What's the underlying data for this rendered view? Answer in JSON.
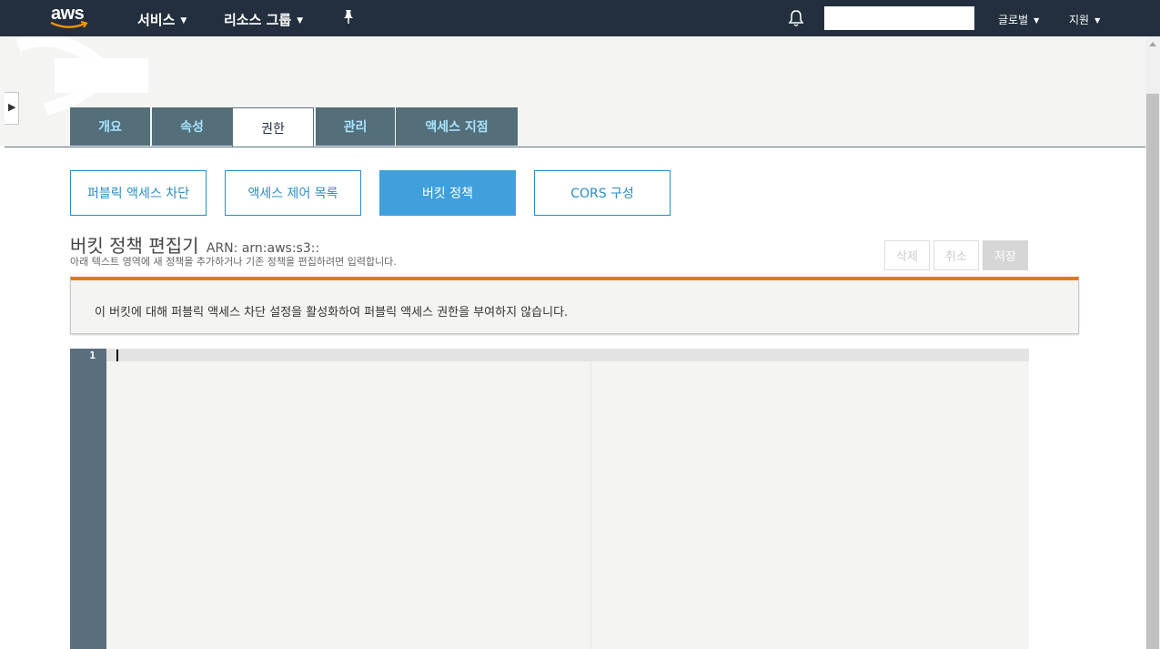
{
  "topnav": {
    "logo": "aws",
    "services": "서비스",
    "resource_groups": "리소스 그룹",
    "pin_icon": "pin-icon",
    "bell_icon": "bell-icon",
    "global": "글로벌",
    "support": "지원"
  },
  "tabs": [
    {
      "label": "개요"
    },
    {
      "label": "속성"
    },
    {
      "label": "권한"
    },
    {
      "label": "관리"
    },
    {
      "label": "액세스 지점"
    }
  ],
  "active_tab": "권한",
  "subtabs": [
    {
      "label": "퍼블릭 액세스 차단"
    },
    {
      "label": "액세스 제어 목록"
    },
    {
      "label": "버킷 정책"
    },
    {
      "label": "CORS 구성"
    }
  ],
  "active_subtab": "버킷 정책",
  "editor": {
    "title": "버킷 정책 편집기",
    "arn": "ARN: arn:aws:s3::",
    "description": "아래 텍스트 영역에 새 정책을 추가하거나 기존 정책을 편집하려면 입력합니다.",
    "delete_label": "삭제",
    "cancel_label": "취소",
    "save_label": "저장",
    "line_number": "1"
  },
  "warning": {
    "text": "이 버킷에 대해 퍼블릭 액세스 차단 설정을 활성화하여 퍼블릭 액세스 권한을 부여하지 않습니다.",
    "color": "#e07b12"
  },
  "colors": {
    "nav_bg": "#232f3e",
    "tab_bg": "#546e7a",
    "tab_text": "#a8e4ff",
    "accent": "#3fa0db"
  }
}
